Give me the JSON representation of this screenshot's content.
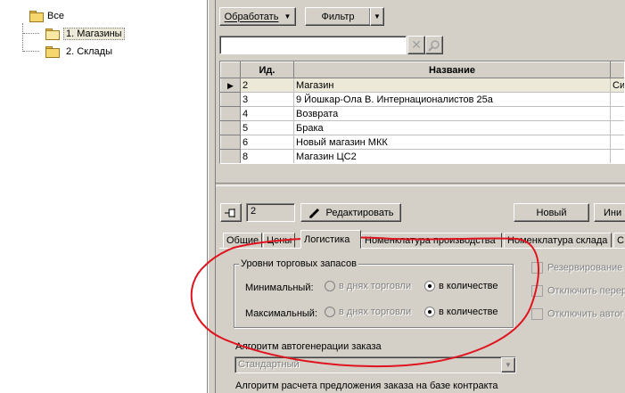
{
  "tree": {
    "root": "Все",
    "items": [
      "1. Магазины",
      "2. Склады"
    ]
  },
  "toolbar": {
    "process_label": "Обработать",
    "filter_label": "Фильтр"
  },
  "search": {
    "value": ""
  },
  "grid": {
    "columns": [
      "Ид.",
      "Название",
      "Си"
    ],
    "rows": [
      {
        "id": "2",
        "name": "Магазин",
        "extra": "Сим"
      },
      {
        "id": "3",
        "name": "9 Йошкар-Ола В. Интернационалистов 25а",
        "extra": ""
      },
      {
        "id": "4",
        "name": "Возврата",
        "extra": ""
      },
      {
        "id": "5",
        "name": "Брака",
        "extra": ""
      },
      {
        "id": "6",
        "name": "Новый магазин МКК",
        "extra": ""
      },
      {
        "id": "8",
        "name": "Магазин ЦС2",
        "extra": ""
      }
    ]
  },
  "editor": {
    "id_value": "2",
    "edit_label": "Редактировать",
    "new_label": "Новый",
    "more_label": "Ини"
  },
  "tabs": [
    "Общие",
    "Цены",
    "Логистика",
    "Номенклатура производства",
    "Номенклатура склада",
    "С"
  ],
  "logistics": {
    "group_title": "Уровни торговых запасов",
    "min_label": "Минимальный:",
    "max_label": "Максимальный:",
    "opt_days": "в днях торговли",
    "opt_qty": "в количестве",
    "reserve_label": "Резервирование",
    "disable1_label": "Отключить перер",
    "disable2_label": "Отключить автог",
    "algo_label": "Алгоритм автогенерации заказа",
    "algo_value": "Стандартный",
    "contract_label": "Алгоритм расчета предложения заказа на базе контракта"
  },
  "colors": {
    "annotation": "#e0141e"
  }
}
